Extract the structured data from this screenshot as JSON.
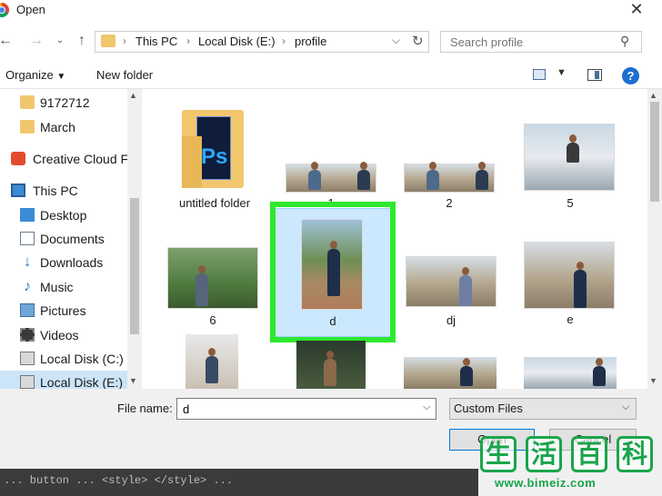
{
  "window": {
    "title": "Open"
  },
  "nav": {
    "breadcrumb": [
      "This PC",
      "Local Disk (E:)",
      "profile"
    ],
    "search_placeholder": "Search profile"
  },
  "toolbar": {
    "organize": "Organize",
    "new_folder": "New folder"
  },
  "sidebar": {
    "items": [
      {
        "label": "9172712",
        "icon": "folder-icon"
      },
      {
        "label": "March",
        "icon": "folder-icon"
      },
      {
        "label": "Creative Cloud Fil",
        "icon": "creative-cloud-icon"
      },
      {
        "label": "This PC",
        "icon": "computer-icon"
      },
      {
        "label": "Desktop",
        "icon": "desktop-icon"
      },
      {
        "label": "Documents",
        "icon": "documents-icon"
      },
      {
        "label": "Downloads",
        "icon": "downloads-icon"
      },
      {
        "label": "Music",
        "icon": "music-icon"
      },
      {
        "label": "Pictures",
        "icon": "pictures-icon"
      },
      {
        "label": "Videos",
        "icon": "videos-icon"
      },
      {
        "label": "Local Disk (C:)",
        "icon": "drive-icon"
      },
      {
        "label": "Local Disk (E:)",
        "icon": "drive-icon",
        "selected": true
      }
    ]
  },
  "files": [
    {
      "name": "untitled folder",
      "type": "folder"
    },
    {
      "name": "1",
      "type": "image"
    },
    {
      "name": "2",
      "type": "image"
    },
    {
      "name": "5",
      "type": "image"
    },
    {
      "name": "6",
      "type": "image"
    },
    {
      "name": "d",
      "type": "image",
      "selected": true
    },
    {
      "name": "dj",
      "type": "image"
    },
    {
      "name": "e",
      "type": "image"
    }
  ],
  "bottom": {
    "file_name_label": "File name:",
    "file_name_value": "d",
    "file_type": "Custom Files",
    "open_label": "Open",
    "cancel_label": "Cancel"
  },
  "watermark": {
    "chars": [
      "生",
      "活",
      "百",
      "科"
    ],
    "url": "www.bimeiz.com"
  },
  "background_code": "... button ... <style> </style> ...",
  "colors": {
    "highlight": "#2ee82e",
    "selection": "#cce8ff",
    "accent": "#0078d7"
  }
}
